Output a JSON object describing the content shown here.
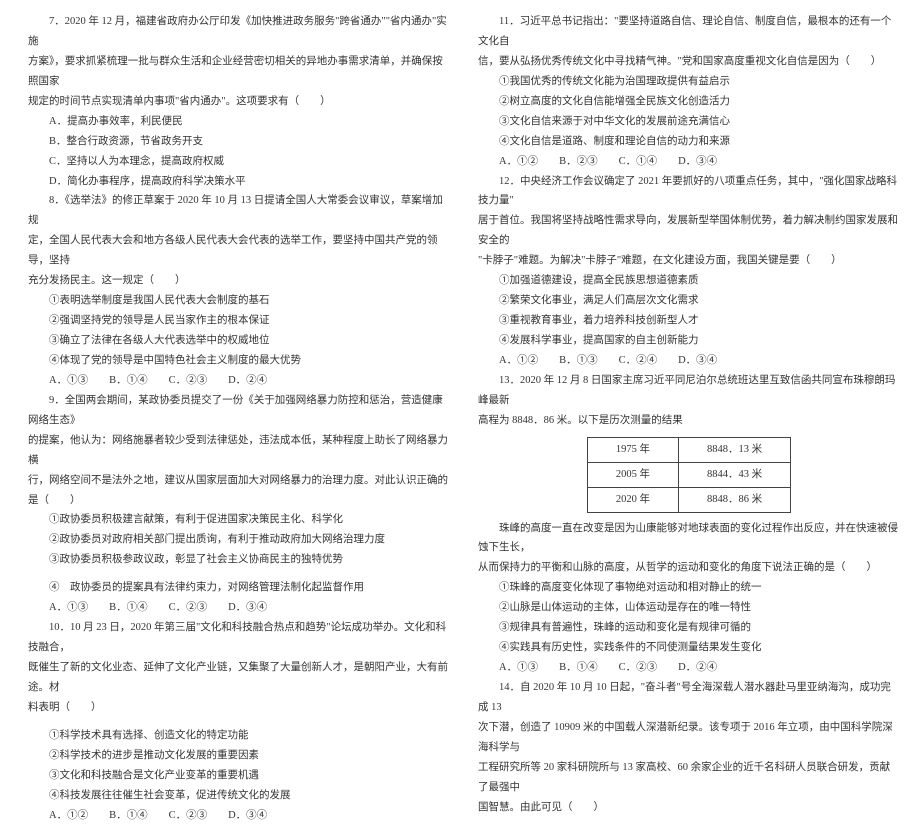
{
  "left": {
    "q7a": "7．2020 年 12 月，福建省政府办公厅印发《加快推进政务服务\"跨省通办\"\"省内通办\"实施",
    "q7b": "方案》，要求抓紧梳理一批与群众生活和企业经营密切相关的异地办事需求清单，并确保按照国家",
    "q7c": "规定的时间节点实现清单内事项\"省内通办\"。这项要求有（　　）",
    "q7_A": "A．提高办事效率，利民便民",
    "q7_B": "B．整合行政资源，节省政务开支",
    "q7_C": "C．坚持以人为本理念，提高政府权威",
    "q7_D": "D．简化办事程序，提高政府科学决策水平",
    "q8a": "8．《选举法》的修正草案于 2020 年 10 月 13 日提请全国人大常委会议审议，草案增加规",
    "q8b": "定，全国人民代表大会和地方各级人民代表大会代表的选举工作，要坚持中国共产党的领导，坚持",
    "q8c": "充分发扬民主。这一规定（　　）",
    "q8_1": "①表明选举制度是我国人民代表大会制度的基石",
    "q8_2": "②强调坚持党的领导是人民当家作主的根本保证",
    "q8_3": "③确立了法律在各级人大代表选举中的权威地位",
    "q8_4": "④体现了党的领导是中国特色社会主义制度的最大优势",
    "q8_opts": "A．①③　　B．①④　　C．②③　　D．②④",
    "q9a": "9．全国两会期间，某政协委员提交了一份《关于加强网络暴力防控和惩治，营造健康网络生态》",
    "q9b": "的提案，他认为：网络施暴者较少受到法律惩处，违法成本低，某种程度上助长了网络暴力横",
    "q9c": "行，网络空间不是法外之地，建议从国家层面加大对网络暴力的治理力度。对此认识正确的是（　　）",
    "q9_1": "①政协委员积极建言献策，有利于促进国家决策民主化、科学化",
    "q9_2": "②政协委员对政府相关部门提出质询，有利于推动政府加大网络治理力度",
    "q9_3": "③政协委员积极参政议政，彰显了社会主义协商民主的独特优势",
    "q9_4": "④　政协委员的提案具有法律约束力，对网络管理法制化起监督作用",
    "q9_opts": "A．①③　　B．①④　　C．②③　　D．③④",
    "q10a": "10．10 月 23 日，2020 年第三届\"文化和科技融合热点和趋势\"论坛成功举办。文化和科技融合，",
    "q10b": "既催生了新的文化业态、延伸了文化产业链，又集聚了大量创新人才，是朝阳产业，大有前途。材",
    "q10c": "料表明（　　）",
    "q10_1": "①科学技术具有选择、创造文化的特定功能",
    "q10_2": "②科学技术的进步是推动文化发展的重要因素",
    "q10_3": "③文化和科技融合是文化产业变革的重要机遇",
    "q10_4": "④科技发展往往催生社会变革，促进传统文化的发展",
    "q10_opts": "A．①②　　B．①④　　C．②③　　D．③④"
  },
  "right": {
    "q11a": "11．习近平总书记指出：\"要坚持道路自信、理论自信、制度自信，最根本的还有一个文化自",
    "q11b": "信，要从弘扬优秀传统文化中寻找精气神。\"党和国家高度重视文化自信是因为（　　）",
    "q11_1": "①我国优秀的传统文化能为治国理政提供有益启示",
    "q11_2": "②树立高度的文化自信能增强全民族文化创造活力",
    "q11_3": "③文化自信来源于对中华文化的发展前途充满信心",
    "q11_4": "④文化自信是道路、制度和理论自信的动力和来源",
    "q11_opts": "A．①②　　B．②③　　C．①④　　D．③④",
    "q12a": "12．中央经济工作会议确定了 2021 年要抓好的八项重点任务，其中，\"强化国家战略科技力量\"",
    "q12b": "居于首位。我国将坚持战略性需求导向，发展新型举国体制优势，着力解决制约国家发展和安全的",
    "q12c": "\"卡脖子\"难题。为解决\"卡脖子\"难题，在文化建设方面，我国关键是要（　　）",
    "q12_1": "①加强道德建设，提高全民族思想道德素质",
    "q12_2": "②繁荣文化事业，满足人们高层次文化需求",
    "q12_3": "③重视教育事业，着力培养科技创新型人才",
    "q12_4": "④发展科学事业，提高国家的自主创新能力",
    "q12_opts": "A．①②　　B．①③　　C．②④　　D．③④",
    "q13a": "13．2020 年 12 月 8 日国家主席习近平同尼泊尔总统班达里互致信函共同宣布珠穆朗玛峰最新",
    "q13b": "高程为 8848．86 米。以下是历次测量的结果",
    "t_r1c1": "1975 年",
    "t_r1c2": "8848．13 米",
    "t_r2c1": "2005 年",
    "t_r2c2": "8844．43 米",
    "t_r3c1": "2020 年",
    "t_r3c2": "8848．86 米",
    "q13c": "珠峰的高度一直在改变是因为山康能够对地球表面的变化过程作出反应，并在快速被侵蚀下生长，",
    "q13d": "从而保持力的平衡和山脉的高度，从哲学的运动和变化的角度下说法正确的是（　　）",
    "q13_1": "①珠峰的高度变化体现了事物绝对运动和相对静止的统一",
    "q13_2": "②山脉是山体运动的主体，山体运动是存在的唯一特性",
    "q13_3": "③规律具有普遍性，珠峰的运动和变化是有规律可循的",
    "q13_4": "④实践具有历史性，实践条件的不同使测量结果发生变化",
    "q13_opts": "A．①③　　B．①④　　C．②③　　D．②④",
    "q14a": "14．自 2020 年 10 月 10 日起，\"奋斗者\"号全海深载人潜水器赴马里亚纳海沟，成功完成 13",
    "q14b": "次下潜，创造了 10909 米的中国载人深潜新纪录。该专项于 2016 年立项，由中国科学院深海科学与",
    "q14c": "工程研究所等 20 家科研院所与 13 家高校、60 余家企业的近千名科研人员联合研发，贡献了最强中",
    "q14d": "国智慧。由此可见（　　）"
  }
}
